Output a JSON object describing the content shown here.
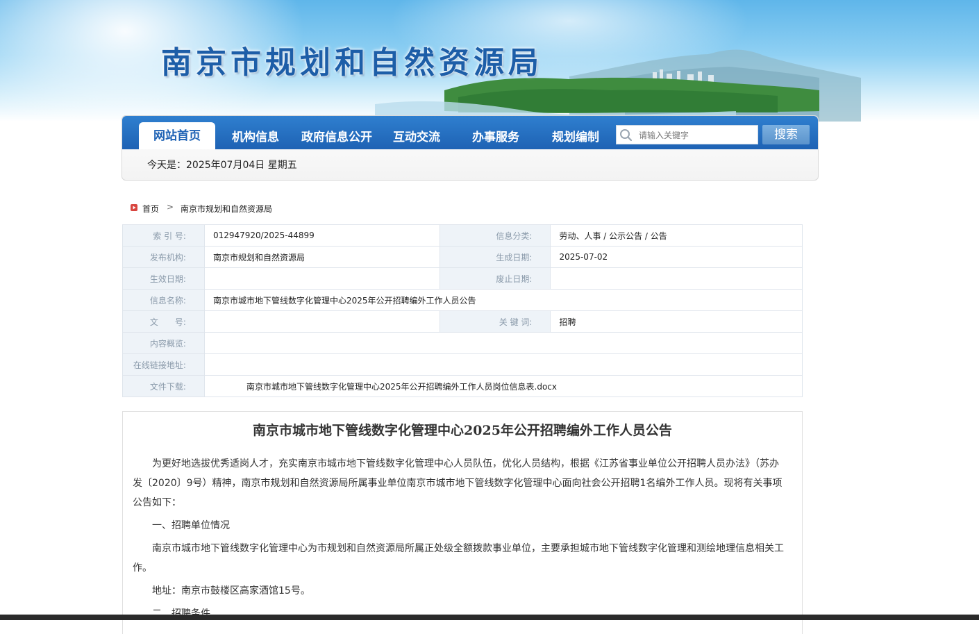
{
  "header": {
    "site_title": "南京市规划和自然资源局"
  },
  "nav": {
    "items": [
      {
        "label": "网站首页",
        "active": true
      },
      {
        "label": "机构信息"
      },
      {
        "label": "政府信息公开"
      },
      {
        "label": "互动交流"
      },
      {
        "label": "办事服务"
      },
      {
        "label": "规划编制"
      }
    ],
    "search_placeholder": "请输入关键字",
    "search_button": "搜索",
    "today": "今天是：2025年07月04日  星期五"
  },
  "breadcrumb": {
    "home": "首页",
    "separator": ">",
    "current": "南京市规划和自然资源局"
  },
  "info": {
    "index_label": "索 引 号:",
    "index_value": "012947920/2025-44899",
    "category_label": "信息分类:",
    "category_value": "劳动、人事 / 公示公告 / 公告",
    "publisher_label": "发布机构:",
    "publisher_value": "南京市规划和自然资源局",
    "created_label": "生成日期:",
    "created_value": "2025-07-02",
    "effective_label": "生效日期:",
    "effective_value": "",
    "expire_label": "废止日期:",
    "expire_value": "",
    "name_label": "信息名称:",
    "name_value": "南京市城市地下管线数字化管理中心2025年公开招聘编外工作人员公告",
    "doc_label": "文　　号:",
    "doc_value": "",
    "keyword_label": "关 键 词:",
    "keyword_value": "招聘",
    "overview_label": "内容概览:",
    "overview_value": "",
    "link_label": "在线链接地址:",
    "link_value": "",
    "download_label": "文件下载:",
    "download_value": "南京市城市地下管线数字化管理中心2025年公开招聘编外工作人员岗位信息表.docx"
  },
  "article": {
    "title": "南京市城市地下管线数字化管理中心2025年公开招聘编外工作人员公告",
    "paragraphs": [
      "为更好地选拔优秀适岗人才，充实南京市城市地下管线数字化管理中心人员队伍，优化人员结构，根据《江苏省事业单位公开招聘人员办法》（苏办发〔2020〕9号）精神，南京市规划和自然资源局所属事业单位南京市城市地下管线数字化管理中心面向社会公开招聘1名编外工作人员。现将有关事项公告如下：",
      "一、招聘单位情况",
      "南京市城市地下管线数字化管理中心为市规划和自然资源局所属正处级全额拨款事业单位，主要承担城市地下管线数字化管理和测绘地理信息相关工作。",
      "地址：南京市鼓楼区高家酒馆15号。",
      "二、招聘条件"
    ]
  },
  "colors": {
    "nav_blue": "#1e62b4",
    "title_blue": "#1d5ea8",
    "label_bg": "#eef3f8"
  }
}
